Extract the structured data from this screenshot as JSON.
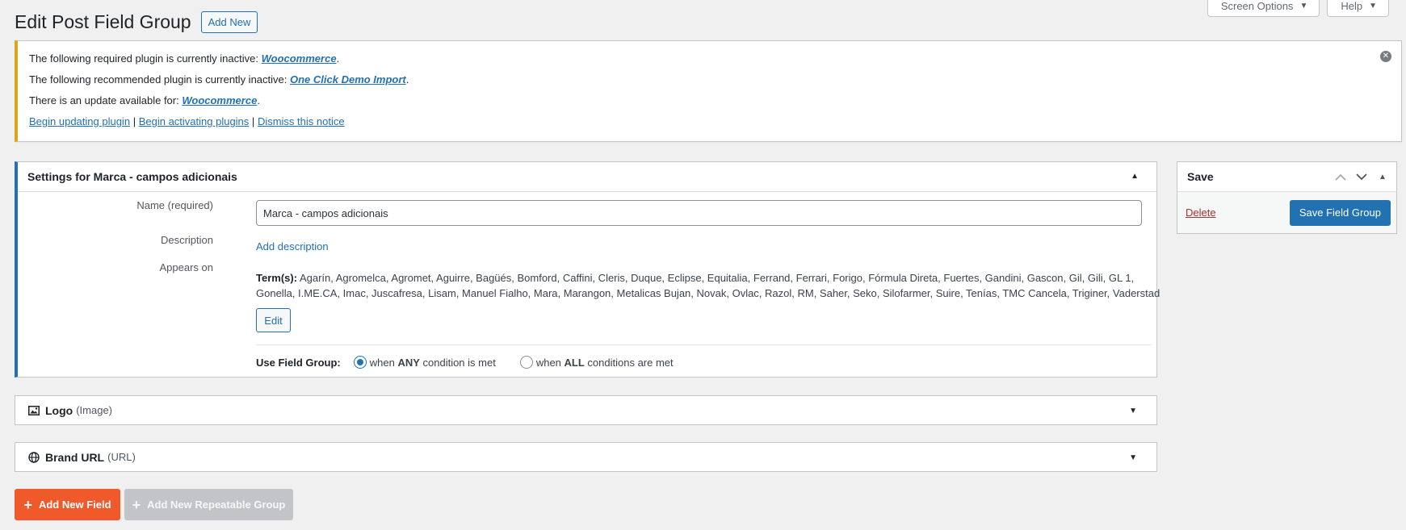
{
  "header": {
    "title": "Edit Post Field Group",
    "add_new_label": "Add New",
    "screen_options_label": "Screen Options",
    "help_label": "Help"
  },
  "notice": {
    "line1_prefix": "The following required plugin is currently inactive: ",
    "line1_link": "Woocommerce",
    "line2_prefix": "The following recommended plugin is currently inactive: ",
    "line2_link": "One Click Demo Import",
    "line3_prefix": "There is an update available for: ",
    "line3_link": "Woocommerce",
    "action_update": "Begin updating plugin",
    "action_activate": "Begin activating plugins",
    "action_dismiss": "Dismiss this notice",
    "separator": "|",
    "dismiss_glyph": "✕"
  },
  "settings": {
    "title": "Settings for Marca - campos adicionais",
    "name_label": "Name (required)",
    "name_value": "Marca - campos adicionais",
    "description_label": "Description",
    "add_description": "Add description",
    "appears_on_label": "Appears on",
    "terms_label": "Term(s):",
    "terms_value": "Agarín, Agromelca, Agromet, Aguirre, Bagüés, Bomford, Caffini, Cleris, Duque, Eclipse, Equitalia, Ferrand, Ferrari, Forigo, Fórmula Direta, Fuertes, Gandini, Gascon, Gil, Gili, GL 1, Gonella, I.ME.CA, Imac, Juscafresa, Lisam, Manuel Fialho, Mara, Marangon, Metalicas Bujan, Novak, Ovlac, Razol, RM, Saher, Seko, Silofarmer, Suire, Tenías, TMC Cancela, Triginer, Vaderstad",
    "edit_label": "Edit",
    "use_field_group_label": "Use Field Group:",
    "radio_any_prefix": "when ",
    "radio_any_strong": "ANY",
    "radio_any_suffix": " condition is met",
    "radio_all_prefix": "when ",
    "radio_all_strong": "ALL",
    "radio_all_suffix": " conditions are met",
    "selected_condition": "any"
  },
  "fields": [
    {
      "name": "Logo",
      "type": "(Image)",
      "icon": "image-icon"
    },
    {
      "name": "Brand URL",
      "type": "(URL)",
      "icon": "globe-icon"
    }
  ],
  "buttons": {
    "add_new_field": "Add New Field",
    "add_new_repeatable_group": "Add New Repeatable Group"
  },
  "save_box": {
    "title": "Save",
    "delete_label": "Delete",
    "save_label": "Save Field Group"
  },
  "colors": {
    "primary": "#2271b1",
    "notice_warning": "#dba617",
    "add_field": "#f0592a",
    "delete": "#b32d2e"
  }
}
